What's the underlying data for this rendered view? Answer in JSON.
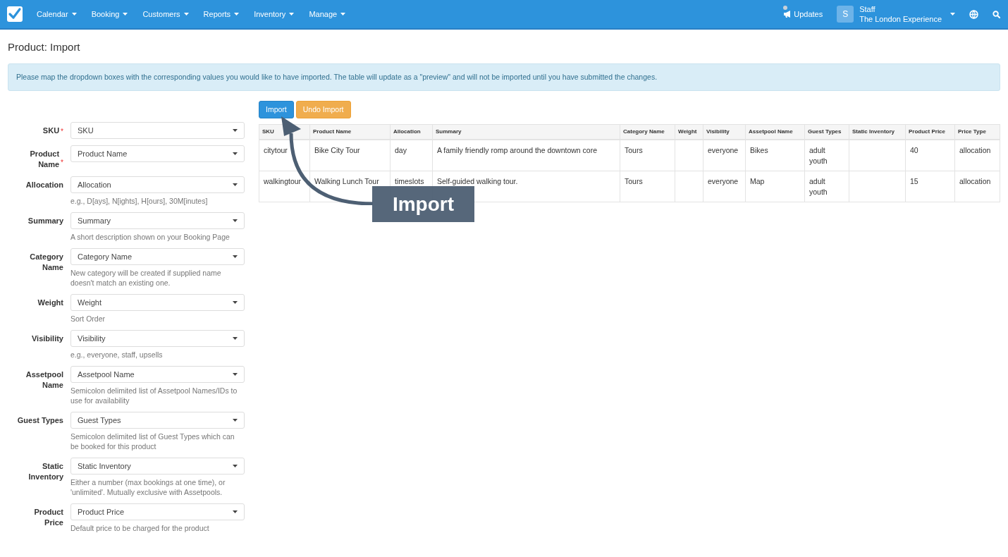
{
  "navbar": {
    "menus": [
      {
        "label": "Calendar"
      },
      {
        "label": "Booking"
      },
      {
        "label": "Customers"
      },
      {
        "label": "Reports"
      },
      {
        "label": "Inventory"
      },
      {
        "label": "Manage"
      }
    ],
    "updates": {
      "label": "Updates"
    },
    "user": {
      "initial": "S",
      "role": "Staff",
      "company": "The London Experience"
    }
  },
  "page_title": "Product: Import",
  "required_mark": "*",
  "info_alert": "Please map the dropdown boxes with the corresponding values you would like to have imported. The table will update as a \"preview\" and will not be imported until you have submitted the changes.",
  "mapping_fields": [
    {
      "label": "SKU",
      "required": true,
      "value": "SKU"
    },
    {
      "label": "Product Name",
      "required": true,
      "value": "Product Name"
    },
    {
      "label": "Allocation",
      "required": false,
      "value": "Allocation",
      "help": "e.g., D[ays], N[ights], H[ours], 30M[inutes]"
    },
    {
      "label": "Summary",
      "required": false,
      "value": "Summary",
      "help": "A short description shown on your Booking Page"
    },
    {
      "label": "Category Name",
      "required": false,
      "value": "Category Name",
      "help": "New category will be created if supplied name doesn't match an existing one."
    },
    {
      "label": "Weight",
      "required": false,
      "value": "Weight",
      "help": "Sort Order"
    },
    {
      "label": "Visibility",
      "required": false,
      "value": "Visibility",
      "help": "e.g., everyone, staff, upsells"
    },
    {
      "label": "Assetpool Name",
      "required": false,
      "value": "Assetpool Name",
      "help": "Semicolon delimited list of Assetpool Names/IDs to use for availability"
    },
    {
      "label": "Guest Types",
      "required": false,
      "value": "Guest Types",
      "help": "Semicolon delimited list of Guest Types which can be booked for this product"
    },
    {
      "label": "Static Inventory",
      "required": false,
      "value": "Static Inventory",
      "help": "Either a number (max bookings at one time), or 'unlimited'. Mutually exclusive with Assetpools."
    },
    {
      "label": "Product Price",
      "required": false,
      "value": "Product Price",
      "help": "Default price to be charged for the product"
    }
  ],
  "buttons": [
    {
      "label": "Import",
      "kind": "primary"
    },
    {
      "label": "Undo Import",
      "kind": "warning"
    }
  ],
  "table": {
    "columns": [
      "SKU",
      "Product Name",
      "Allocation",
      "Summary",
      "Category Name",
      "Weight",
      "Visibility",
      "Assetpool Name",
      "Guest Types",
      "Static Inventory",
      "Product Price",
      "Price Type"
    ],
    "rows": [
      [
        "citytour",
        "Bike City Tour",
        "day",
        "A family friendly romp around the downtown core",
        "Tours",
        null,
        "everyone",
        "Bikes",
        "adult\nyouth",
        null,
        "40",
        "allocation"
      ],
      [
        "walkingtour",
        "Walking Lunch Tour",
        "timeslots",
        "Self-guided walking tour.",
        "Tours",
        null,
        "everyone",
        "Map",
        "adult\nyouth",
        null,
        "15",
        "allocation"
      ]
    ]
  },
  "annotation": {
    "label": "Import"
  }
}
